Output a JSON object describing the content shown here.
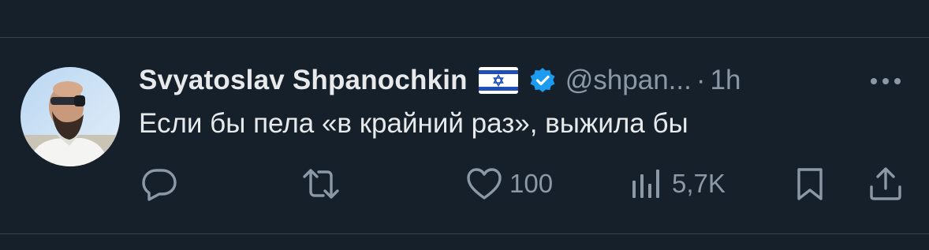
{
  "tweet": {
    "author": {
      "display_name": "Svyatoslav Shpanochkin",
      "flag_icon": "israel-flag-icon",
      "verified_icon": "verified-badge-icon",
      "verified_color": "#1d9bf0",
      "handle": "@shpan...",
      "separator": "·",
      "time": "1h"
    },
    "text": "Если бы пела «в крайний раз», выжила бы",
    "actions": {
      "reply_icon": "reply-icon",
      "retweet_icon": "retweet-icon",
      "like_icon": "heart-icon",
      "like_count": "100",
      "views_icon": "views-icon",
      "views_count": "5,7K",
      "bookmark_icon": "bookmark-icon",
      "share_icon": "share-icon"
    },
    "more_icon": "more-icon"
  },
  "colors": {
    "background": "#15202b",
    "text": "#e7e9ea",
    "secondary": "#8b98a5",
    "divider": "#38444d"
  }
}
